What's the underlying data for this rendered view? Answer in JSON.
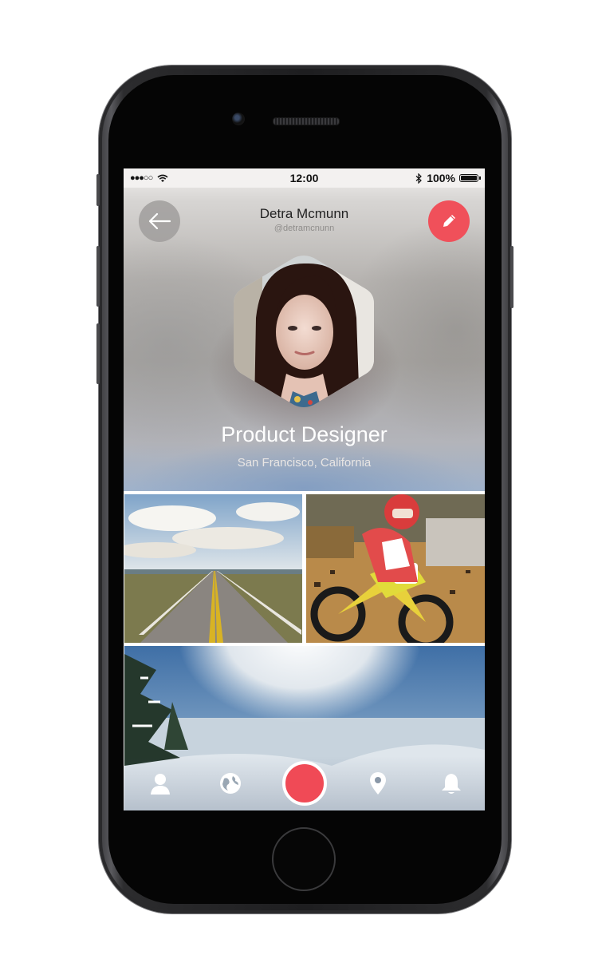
{
  "status_bar": {
    "signal": "●●●○○",
    "time": "12:00",
    "battery": "100%"
  },
  "profile": {
    "name": "Detra Mcmunn",
    "handle": "@detramcnunn",
    "title": "Product Designer",
    "location": "San Francisco, California"
  },
  "header": {
    "back_icon": "arrow-left-icon",
    "edit_icon": "pencil-icon"
  },
  "photos": [
    {
      "subject": "road"
    },
    {
      "subject": "motocross"
    },
    {
      "subject": "snow"
    }
  ],
  "tabbar": {
    "items": [
      "user-icon",
      "globe-icon",
      "record-button",
      "location-pin-icon",
      "bell-icon"
    ]
  },
  "colors": {
    "accent": "#f0505a",
    "white": "#ffffff"
  }
}
